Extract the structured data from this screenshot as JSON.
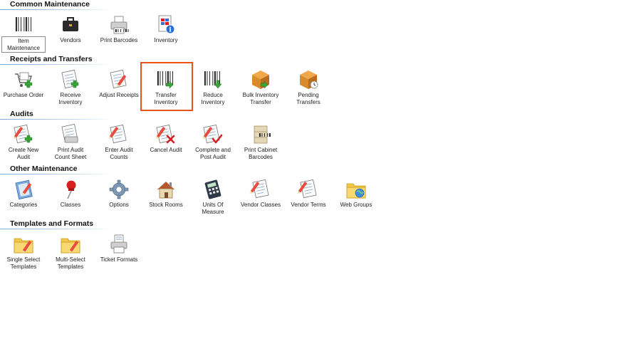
{
  "sections": [
    {
      "title": "Common Maintenance",
      "items": [
        {
          "label": "Item\nMaintenance",
          "icon": "barcode-icon"
        },
        {
          "label": "Vendors",
          "icon": "briefcase-icon"
        },
        {
          "label": "Print Barcodes",
          "icon": "printer-icon"
        },
        {
          "label": "Inventory",
          "icon": "inventory-info-icon"
        }
      ]
    },
    {
      "title": "Receipts and Transfers",
      "items": [
        {
          "label": "Purchase Order",
          "icon": "cart-icon"
        },
        {
          "label": "Receive\nInventory",
          "icon": "document-add-icon"
        },
        {
          "label": "Adjust Receipts",
          "icon": "document-edit-icon"
        },
        {
          "label": "Transfer\nInventory",
          "icon": "barcode-transfer-icon"
        },
        {
          "label": "Reduce\nInventory",
          "icon": "barcode-reduce-icon"
        },
        {
          "label": "Bulk Inventory\nTransfer",
          "icon": "box-transfer-icon"
        },
        {
          "label": "Pending\nTransfers",
          "icon": "box-pending-icon"
        }
      ]
    },
    {
      "title": "Audits",
      "items": [
        {
          "label": "Create New\nAudit",
          "icon": "audit-add-icon"
        },
        {
          "label": "Print Audit\nCount Sheet",
          "icon": "audit-print-icon"
        },
        {
          "label": "Enter Audit\nCounts",
          "icon": "audit-edit-icon"
        },
        {
          "label": "Cancel Audit",
          "icon": "audit-cancel-icon"
        },
        {
          "label": "Complete and\nPost Audit",
          "icon": "audit-complete-icon"
        },
        {
          "label": "Print Cabinet\nBarcodes",
          "icon": "cabinet-barcode-icon"
        }
      ]
    },
    {
      "title": "Other Maintenance",
      "items": [
        {
          "label": "Categories",
          "icon": "notebook-icon"
        },
        {
          "label": "Classes",
          "icon": "pushpin-icon"
        },
        {
          "label": "Options",
          "icon": "gear-icon"
        },
        {
          "label": "Stock Rooms",
          "icon": "house-icon"
        },
        {
          "label": "Units Of\nMeasure",
          "icon": "calculator-icon"
        },
        {
          "label": "Vendor Classes",
          "icon": "document-pencil-icon"
        },
        {
          "label": "Vendor Terms",
          "icon": "document-pencil-icon"
        },
        {
          "label": "Web Groups",
          "icon": "folder-globe-icon"
        }
      ]
    },
    {
      "title": "Templates and Formats",
      "items": [
        {
          "label": "Single Select\nTemplates",
          "icon": "folder-pencil-icon"
        },
        {
          "label": "Multi-Select\nTemplates",
          "icon": "folder-pencil-icon"
        },
        {
          "label": "Ticket Formats",
          "icon": "ticket-printer-icon"
        }
      ]
    }
  ],
  "selected_item": "Item\nMaintenance",
  "highlighted_item": "Transfer\nInventory",
  "colors": {
    "highlight_border": "#e8541e",
    "section_line": "#7ba7d6",
    "green_arrow": "#3aa63a",
    "red_mark": "#d62020",
    "box_orange": "#d98a2b",
    "folder_yellow": "#f2c94c"
  }
}
